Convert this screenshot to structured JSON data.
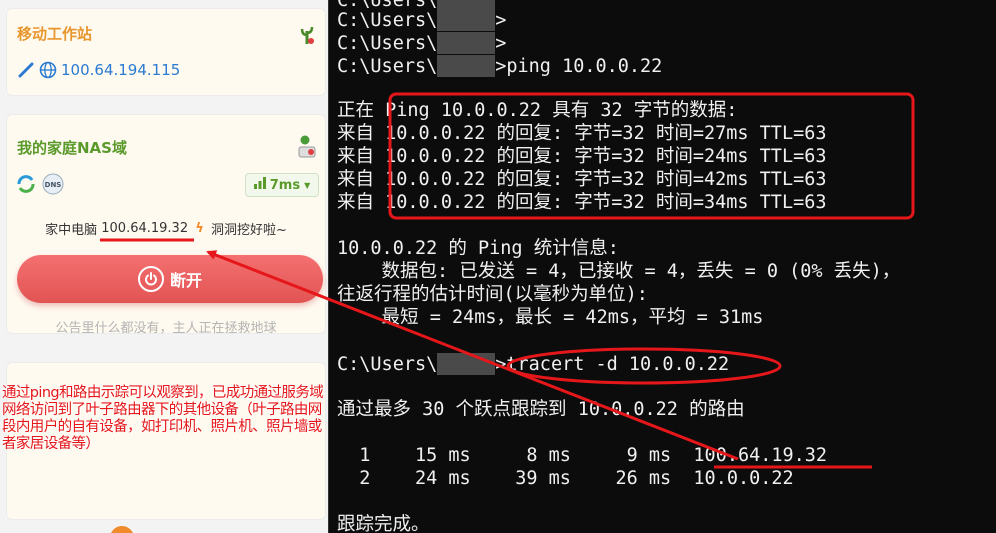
{
  "app": {
    "card1": {
      "title": "移动工作站",
      "ip": "100.64.194.115",
      "corner_icon": "cactus-plant-icon"
    },
    "card2": {
      "title": "我的家庭NAS域",
      "corner_icon": "server-alert-icon",
      "latency": "7ms",
      "device_name": "家中电脑",
      "device_ip": "100.64.19.32",
      "device_status": "洞洞挖好啦~",
      "disconnect_label": "断开",
      "notice": "公告里什么都没有，主人正在拯救地球"
    }
  },
  "annotation": {
    "text": "通过ping和路由示踪可以观察到，已成功通过服务域网络访问到了叶子路由器下的其他设备（叶子路由网段内用户的自有设备，如打印机、照片机、照片墙或者家居设备等）"
  },
  "terminal": {
    "prompt_prefix": "C:\\Users\\",
    "lines": {
      "l0": "C:\\Users\\",
      "l1_suffix": ">",
      "l2_suffix": ">",
      "l3_suffix": ">ping 10.0.0.22",
      "ping_header": "正在 Ping 10.0.0.22 具有 32 字节的数据:",
      "reply1": "来自 10.0.0.22 的回复: 字节=32 时间=27ms TTL=63",
      "reply2": "来自 10.0.0.22 的回复: 字节=32 时间=24ms TTL=63",
      "reply3": "来自 10.0.0.22 的回复: 字节=32 时间=42ms TTL=63",
      "reply4": "来自 10.0.0.22 的回复: 字节=32 时间=34ms TTL=63",
      "stats_title": "10.0.0.22 的 Ping 统计信息:",
      "stats_packets": "    数据包: 已发送 = 4，已接收 = 4，丢失 = 0 (0% 丢失)，",
      "stats_rtt_title": "往返行程的估计时间(以毫秒为单位):",
      "stats_rtt": "    最短 = 24ms，最长 = 42ms，平均 = 31ms",
      "tracert_suffix": ">tracert -d 10.0.0.22",
      "tracert_header": "通过最多 30 个跃点跟踪到 10.0.0.22 的路由",
      "hop1": "  1    15 ms     8 ms     9 ms  100.64.19.32",
      "hop2": "  2    24 ms    39 ms    26 ms  10.0.0.22",
      "trace_done": "跟踪完成。"
    }
  },
  "colors": {
    "annotation_red": "#e5171a",
    "terminal_bg": "#0c0c0c",
    "disconnect_red": "#e25454"
  }
}
